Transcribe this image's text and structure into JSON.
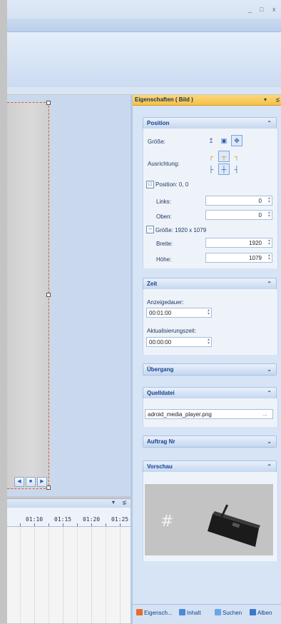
{
  "window": {
    "buttons": [
      "_",
      "□",
      "x"
    ]
  },
  "canvas_nav": [
    "◀",
    "■",
    "▶"
  ],
  "timeline": {
    "header_icons": [
      "▾",
      "⪱"
    ],
    "ticks": [
      "01:10",
      "01:15",
      "01:20",
      "01:25"
    ]
  },
  "panel": {
    "title": "Eigenschaften ( Bild )",
    "pin_icons": [
      "▾",
      "⪱"
    ],
    "sections": {
      "position": {
        "title": "Position",
        "groesse_label": "Größe:",
        "ausrichtung_label": "Ausrichtung:",
        "position_summary": "Position: 0, 0",
        "links_label": "Links:",
        "links_value": "0",
        "oben_label": "Oben:",
        "oben_value": "0",
        "groesse_summary": "Größe: 1920 x 1079",
        "breite_label": "Breite:",
        "breite_value": "1920",
        "hoehe_label": "Höhe:",
        "hoehe_value": "1079"
      },
      "zeit": {
        "title": "Zeit",
        "anzeigedauer_label": "Anzeigedauer:",
        "anzeigedauer_value": "00:01:00",
        "aktualisierung_label": "Aktualisierungszeit:",
        "aktualisierung_value": "00:00:00"
      },
      "uebergang": {
        "title": "Übergang"
      },
      "quelldatei": {
        "title": "Quelldatei",
        "file": "adroid_media_player.png",
        "browse": "..."
      },
      "auftrag": {
        "title": "Auftrag Nr"
      },
      "vorschau": {
        "title": "Vorschau",
        "overlay_hash": "#"
      }
    }
  },
  "bottom_tabs": [
    "Eigensch...",
    "Inhalt",
    "Suchen",
    "Alben"
  ],
  "colors": {
    "accent": "#f6c146",
    "panel_bg": "#d6e4f6",
    "header_text": "#15428b",
    "selection_border": "#e05a2c"
  }
}
